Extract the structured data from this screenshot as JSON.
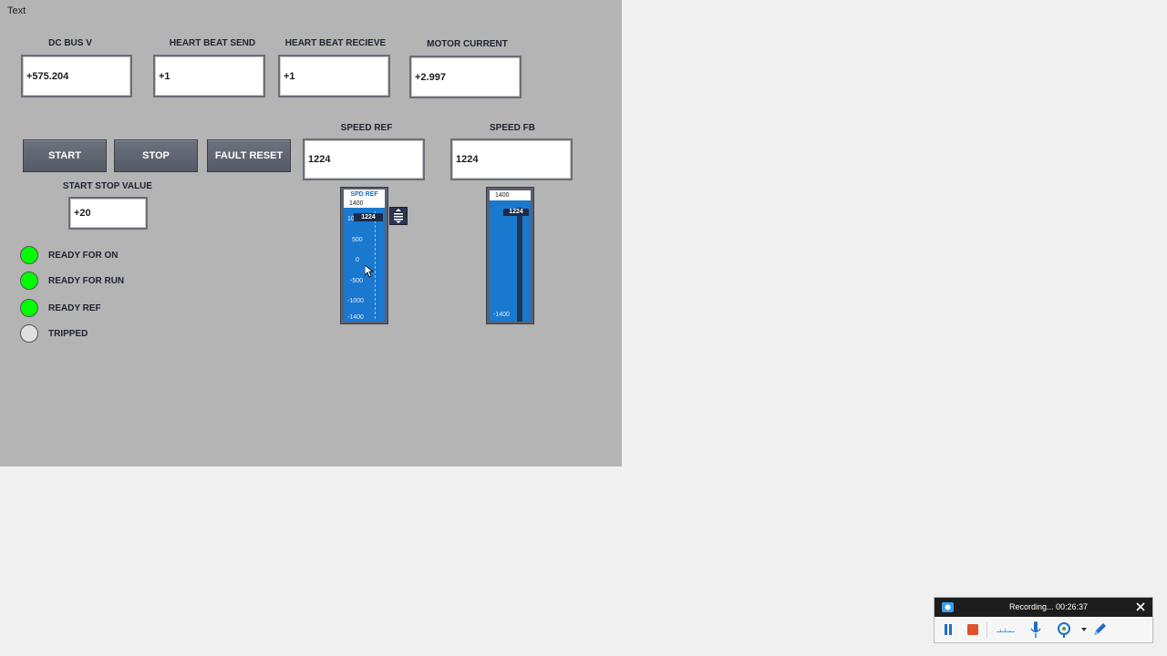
{
  "window": {
    "title": "Text"
  },
  "fields": {
    "dc_bus": {
      "label": "DC BUS V",
      "value": "+575.204"
    },
    "hb_send": {
      "label": "HEART BEAT SEND",
      "value": "+1"
    },
    "hb_recv": {
      "label": "HEART BEAT RECIEVE",
      "value": "+1"
    },
    "motor_current": {
      "label": "MOTOR CURRENT",
      "value": "+2.997"
    },
    "speed_ref": {
      "label": "SPEED REF",
      "value": "1224"
    },
    "speed_fb": {
      "label": "SPEED FB",
      "value": "1224"
    },
    "start_stop": {
      "label": "START STOP VALUE",
      "value": "+20"
    }
  },
  "buttons": {
    "start": "START",
    "stop": "STOP",
    "fault_reset": "FAULT RESET"
  },
  "status": [
    {
      "label": "READY FOR ON",
      "color": "#00ff00"
    },
    {
      "label": "READY FOR RUN",
      "color": "#00ff00"
    },
    {
      "label": "READY REF",
      "color": "#00ff00"
    },
    {
      "label": "TRIPPED",
      "color": "#e0e0e0"
    }
  ],
  "spd_ref_slider": {
    "title": "SPD REF",
    "value": 1224,
    "value_label": "1224",
    "max_label": "1400",
    "ticks": [
      "1000",
      "500",
      "0",
      "-500",
      "-1000",
      "-1400"
    ]
  },
  "spd_fb_bar": {
    "value": 1224,
    "value_label": "1224",
    "max_label": "1400",
    "min_label": "-1400"
  },
  "recorder": {
    "status": "Recording... 00:26:37"
  },
  "colors": {
    "panel": "#b4b4b4",
    "bar": "#1a78cf",
    "lamp_on": "#00ff00",
    "lamp_off": "#e0e0e0"
  }
}
